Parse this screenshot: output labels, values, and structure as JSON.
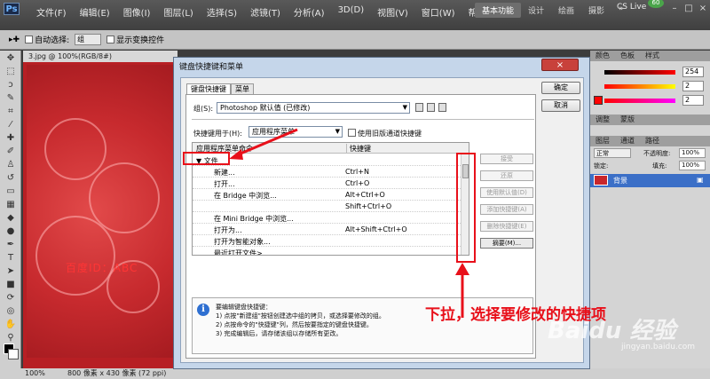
{
  "app": {
    "logo": "Ps"
  },
  "menu": [
    "文件(F)",
    "编辑(E)",
    "图像(I)",
    "图层(L)",
    "选择(S)",
    "滤镜(T)",
    "分析(A)",
    "3D(D)",
    "视图(V)",
    "窗口(W)",
    "帮助(H)"
  ],
  "workspace": {
    "items": [
      "基本功能",
      "设计",
      "绘画",
      "摄影"
    ],
    "more": "»"
  },
  "cslive": {
    "label": "CS Live",
    "badge": "60"
  },
  "window_controls": [
    "–",
    "□",
    "×"
  ],
  "options_bar": {
    "auto_select_label": "自动选择:",
    "auto_select_value": "组",
    "show_transform_label": "显示变换控件"
  },
  "document": {
    "tab_title": "3.jpg @ 100%(RGB/8#)",
    "watermark": "百度ID：ABC",
    "zoom": "100%",
    "size": "800 像素 x 430 像素 (72 ppi)"
  },
  "panels": {
    "color_tabs": [
      "颜色",
      "色板",
      "样式"
    ],
    "slider_values": [
      "254",
      "2",
      "2"
    ],
    "adjust_tabs": [
      "调整",
      "蒙版"
    ],
    "layer_tabs": [
      "图层",
      "通道",
      "路径"
    ],
    "layer_mode": "正常",
    "opacity_label": "不透明度:",
    "opacity_value": "100%",
    "lock_label": "锁定:",
    "fill_label": "填充:",
    "fill_value": "100%",
    "layer_name": "背景"
  },
  "dialog": {
    "title": "键盘快捷键和菜单",
    "close": "×",
    "tabs": [
      "键盘快捷键",
      "菜单"
    ],
    "group_label": "组(S):",
    "group_value": "Photoshop 默认值 (已修改)",
    "shortcuts_for_label": "快捷键用于(H):",
    "shortcuts_for_value": "应用程序菜单",
    "legacy_channel_label": "使用旧版通道快捷键",
    "col_command": "应用程序菜单命令",
    "col_shortcut": "快捷键",
    "rows": [
      {
        "command": "▼ 文件",
        "shortcut": ""
      },
      {
        "command": "新建...",
        "shortcut": "Ctrl+N"
      },
      {
        "command": "打开...",
        "shortcut": "Ctrl+O"
      },
      {
        "command": "在 Bridge 中浏览...",
        "shortcut": "Alt+Ctrl+O"
      },
      {
        "command": "",
        "shortcut": "Shift+Ctrl+O"
      },
      {
        "command": "在 Mini Bridge 中浏览...",
        "shortcut": ""
      },
      {
        "command": "打开为...",
        "shortcut": "Alt+Shift+Ctrl+O"
      },
      {
        "command": "打开为智能对象...",
        "shortcut": ""
      },
      {
        "command": "最近打开文件>",
        "shortcut": ""
      }
    ],
    "side_buttons": [
      "接受",
      "还原",
      "使用默认值(D)",
      "添加快捷键(A)",
      "删除快捷键(E)",
      "摘要(M)..."
    ],
    "info_lines": [
      "要编辑键盘快捷键：",
      "1) 点按\"新建组\"按钮创建选中组的拷贝，或选择要修改的组。",
      "2) 点按命令的\"快捷键\"列，然后按要指定的键盘快捷键。",
      "3) 完成编辑后，请存储该组以存储所有更改。"
    ],
    "ok": "确定",
    "cancel": "取消"
  },
  "annotation": {
    "text": "下拉，选择要修改的快捷项"
  },
  "watermark": {
    "brand": "Baidu 经验",
    "url": "jingyan.baidu.com"
  }
}
